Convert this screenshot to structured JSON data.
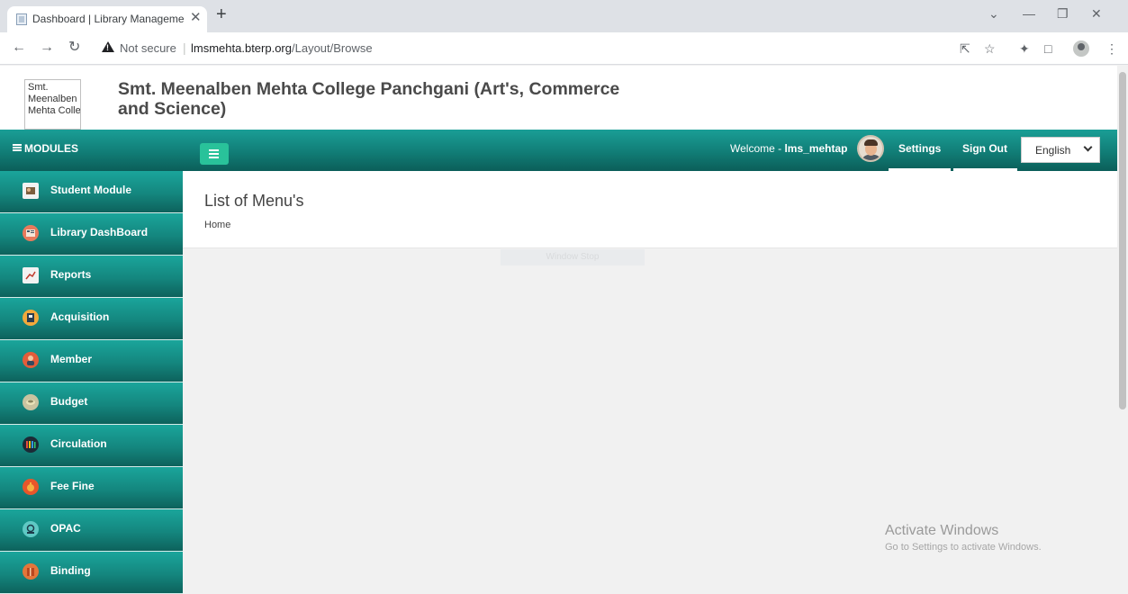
{
  "browser": {
    "tab_title": "Dashboard | Library Management",
    "tab_close": "✕",
    "new_tab": "+",
    "not_secure": "Not secure",
    "url_host": "lmsmehta.bterp.org",
    "url_path": "/Layout/Browse",
    "icons": [
      "back-icon",
      "forward-icon",
      "reload-icon",
      "warning-icon",
      "share-icon",
      "star-icon",
      "extensions-icon",
      "sidepanel-icon",
      "profile-icon",
      "menu-icon"
    ]
  },
  "header": {
    "logo_alt": "Smt. Meenalben Mehta Colle",
    "college_name": "Smt. Meenalben Mehta College Panchgani (Art's, Commerce and Science)"
  },
  "topnav": {
    "modules_label": "MODULES",
    "welcome_prefix": "Welcome - ",
    "username": "lms_mehtap",
    "settings": "Settings",
    "sign_out": "Sign Out",
    "language": "English",
    "accent": "#117d76"
  },
  "sidebar": {
    "items": [
      {
        "label": "Student Module",
        "icon": "student-icon"
      },
      {
        "label": "Library DashBoard",
        "icon": "dashboard-icon"
      },
      {
        "label": "Reports",
        "icon": "reports-icon"
      },
      {
        "label": "Acquisition",
        "icon": "acquisition-icon"
      },
      {
        "label": "Member",
        "icon": "member-icon"
      },
      {
        "label": "Budget",
        "icon": "budget-icon"
      },
      {
        "label": "Circulation",
        "icon": "circulation-icon"
      },
      {
        "label": "Fee Fine",
        "icon": "fee-fine-icon"
      },
      {
        "label": "OPAC",
        "icon": "opac-icon"
      },
      {
        "label": "Binding",
        "icon": "binding-icon"
      }
    ]
  },
  "main": {
    "page_title": "List of Menu's",
    "breadcrumb": "Home",
    "faint_text": "Window Stop"
  },
  "watermark": {
    "line1": "Activate Windows",
    "line2": "Go to Settings to activate Windows."
  }
}
